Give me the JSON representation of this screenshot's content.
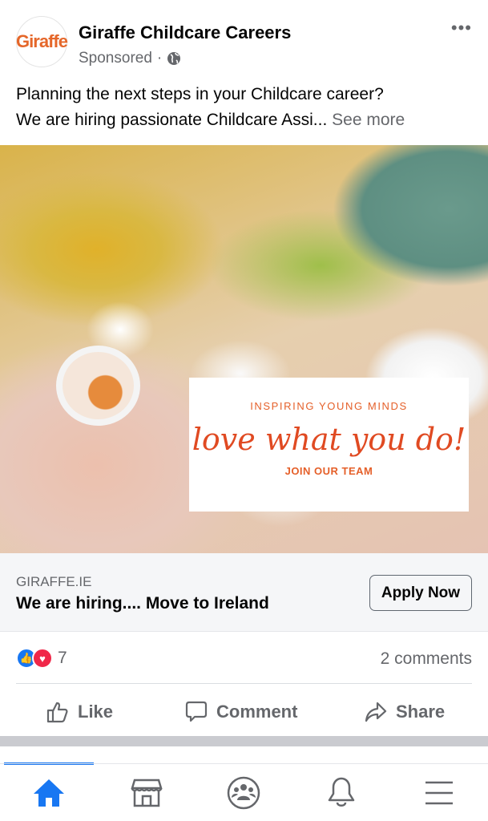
{
  "post": {
    "page_name": "Giraffe Childcare Careers",
    "logo_text": "Giraffe",
    "sponsored": "Sponsored",
    "privacy_icon": "globe-icon",
    "text_line1": "Planning the next steps in your Childcare career?",
    "text_line2": "We are hiring passionate Childcare Assi...",
    "see_more": "See more"
  },
  "ad_image": {
    "tagline": "INSPIRING YOUNG MINDS",
    "headline": "love what you do!",
    "cta": "JOIN OUR TEAM"
  },
  "link": {
    "domain": "GIRAFFE.IE",
    "title": "We are hiring.... Move to Ireland",
    "button": "Apply Now"
  },
  "stats": {
    "reaction_count": "7",
    "comments": "2 comments"
  },
  "actions": {
    "like": "Like",
    "comment": "Comment",
    "share": "Share"
  },
  "nav": {
    "active": "home",
    "items": [
      "home-icon",
      "marketplace-icon",
      "groups-icon",
      "notifications-icon",
      "menu-icon"
    ]
  },
  "colors": {
    "accent": "#1877f2",
    "brand_orange": "#e5602a",
    "love": "#f02849"
  }
}
